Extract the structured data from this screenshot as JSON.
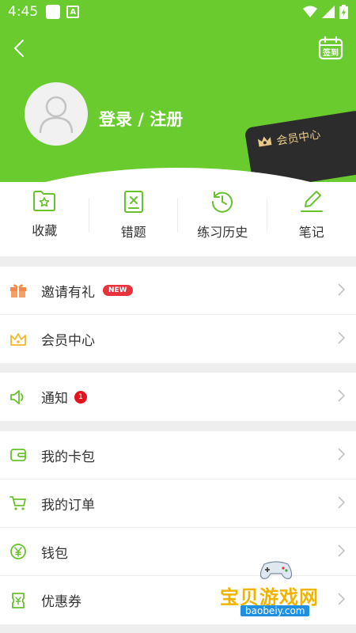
{
  "status_bar": {
    "time": "4:45",
    "notif_letter": "A"
  },
  "header": {
    "login_label": "登录 / 注册",
    "checkin_label": "签到",
    "vip_card_label": "会员中心"
  },
  "quick_actions": [
    {
      "label": "收藏",
      "icon": "star-folder-icon"
    },
    {
      "label": "错题",
      "icon": "wrong-question-icon"
    },
    {
      "label": "练习历史",
      "icon": "history-clock-icon"
    },
    {
      "label": "笔记",
      "icon": "pencil-icon"
    }
  ],
  "menu_group_1": [
    {
      "label": "邀请有礼",
      "badge": "NEW",
      "icon": "gift-icon"
    },
    {
      "label": "会员中心",
      "icon": "crown-icon"
    }
  ],
  "menu_group_2": [
    {
      "label": "通知",
      "badge": "1",
      "icon": "speaker-icon"
    }
  ],
  "menu_group_3": [
    {
      "label": "我的卡包",
      "icon": "wallet-card-icon"
    },
    {
      "label": "我的订单",
      "icon": "cart-icon"
    },
    {
      "label": "钱包",
      "icon": "yuan-coin-icon"
    },
    {
      "label": "优惠券",
      "icon": "coupon-icon"
    }
  ],
  "watermark": {
    "text": "宝贝游戏网",
    "url": "baobeiy.com"
  },
  "colors": {
    "brand_green": "#6acb2f",
    "icon_green": "#6ac12f",
    "new_badge_red": "#e8323c",
    "vip_gold": "#e9c98a"
  }
}
